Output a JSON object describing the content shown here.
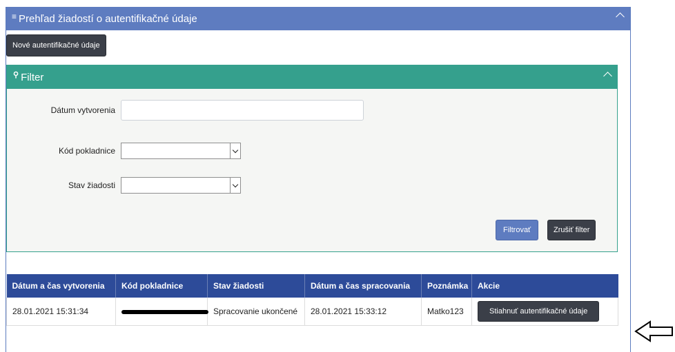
{
  "panel": {
    "title": "Prehľad žiadostí o autentifikačné údaje"
  },
  "toolbar": {
    "new_label": "Nové autentifikačné údaje"
  },
  "filter": {
    "title": "Filter",
    "fields": {
      "created_date": {
        "label": "Dátum vytvorenia",
        "value": ""
      },
      "register_code": {
        "label": "Kód pokladnice",
        "value": ""
      },
      "request_state": {
        "label": "Stav žiadosti",
        "value": ""
      }
    },
    "apply_label": "Filtrovať",
    "clear_label": "Zrušiť filter"
  },
  "table": {
    "columns": [
      "Dátum a čas vytvorenia",
      "Kód pokladnice",
      "Stav žiadosti",
      "Dátum a čas spracovania",
      "Poznámka",
      "Akcie"
    ],
    "rows": [
      {
        "created": "28.01.2021 15:31:34",
        "register_code": "",
        "state": "Spracovanie ukončené",
        "processed": "28.01.2021 15:33:12",
        "note": "Matko123",
        "action_label": "Stiahnuť autentifikačné údaje"
      }
    ]
  },
  "icons": {
    "panel": "hamburger-icon",
    "filter": "search-icon",
    "collapse": "chevron-up-icon",
    "annotation": "left-arrow-icon"
  },
  "colors": {
    "panel_header": "#5e7cc0",
    "filter_header": "#35a08d",
    "table_header": "#2d4b99",
    "dark_button": "#3b3f48"
  }
}
